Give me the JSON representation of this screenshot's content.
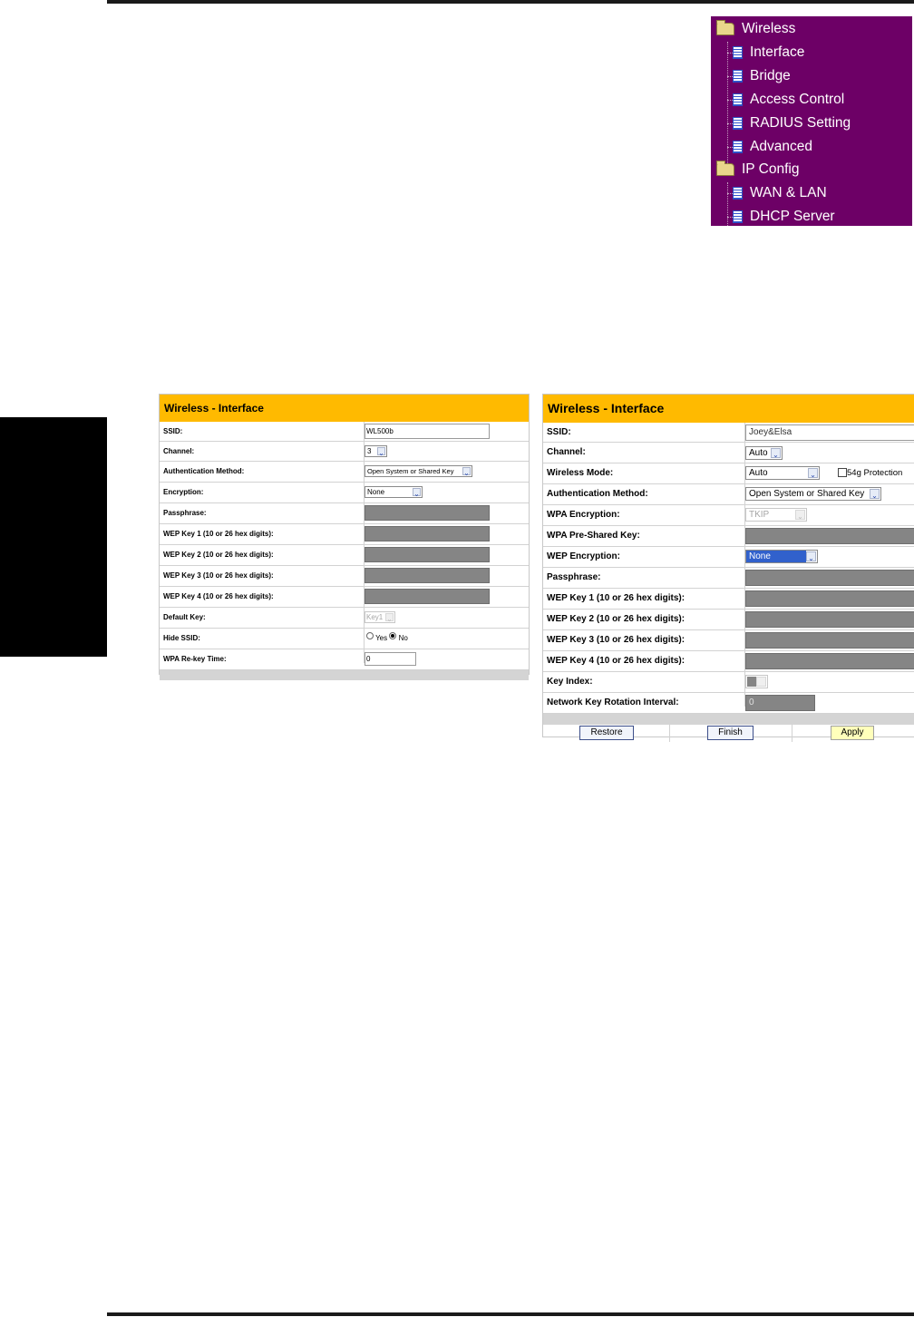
{
  "nav": {
    "items": [
      {
        "label": "Wireless",
        "type": "folder"
      },
      {
        "label": "Interface",
        "type": "page"
      },
      {
        "label": "Bridge",
        "type": "page"
      },
      {
        "label": "Access Control",
        "type": "page"
      },
      {
        "label": "RADIUS Setting",
        "type": "page"
      },
      {
        "label": "Advanced",
        "type": "page"
      },
      {
        "label": "IP Config",
        "type": "folder"
      },
      {
        "label": "WAN & LAN",
        "type": "page"
      },
      {
        "label": "DHCP Server",
        "type": "page"
      }
    ],
    "icons": {
      "folder": "folder-icon",
      "page": "page-icon"
    },
    "colors": {
      "background": "#6d0066",
      "text": "#ffffff"
    }
  },
  "left_panel": {
    "title": "Wireless - Interface",
    "ssid": {
      "label": "SSID:",
      "value": "WL500b"
    },
    "channel": {
      "label": "Channel:",
      "value": "3"
    },
    "auth": {
      "label": "Authentication Method:",
      "value": "Open System or Shared Key"
    },
    "encryption": {
      "label": "Encryption:",
      "value": "None"
    },
    "passphrase": {
      "label": "Passphrase:"
    },
    "wep1": {
      "label": "WEP Key 1 (10 or 26 hex digits):"
    },
    "wep2": {
      "label": "WEP Key 2 (10 or 26 hex digits):"
    },
    "wep3": {
      "label": "WEP Key 3 (10 or 26 hex digits):"
    },
    "wep4": {
      "label": "WEP Key 4 (10 or 26 hex digits):"
    },
    "default_key": {
      "label": "Default Key:",
      "value": "Key1"
    },
    "hide_ssid": {
      "label": "Hide SSID:",
      "yes": "Yes",
      "no": "No",
      "selected": "No"
    },
    "rekey": {
      "label": "WPA Re-key Time:",
      "value": "0"
    }
  },
  "right_panel": {
    "title": "Wireless - Interface",
    "ssid": {
      "label": "SSID:",
      "value": "Joey&Elsa"
    },
    "channel": {
      "label": "Channel:",
      "value": "Auto"
    },
    "mode": {
      "label": "Wireless Mode:",
      "value": "Auto",
      "protection_label": "54g Protection",
      "protection_checked": false
    },
    "auth": {
      "label": "Authentication Method:",
      "value": "Open System or Shared Key"
    },
    "wpa_enc": {
      "label": "WPA Encryption:",
      "value": "TKIP"
    },
    "wpa_psk": {
      "label": "WPA Pre-Shared Key:"
    },
    "wep_enc": {
      "label": "WEP Encryption:",
      "value": "None"
    },
    "passphrase": {
      "label": "Passphrase:"
    },
    "wep1": {
      "label": "WEP Key 1 (10 or 26 hex digits):"
    },
    "wep2": {
      "label": "WEP Key 2 (10 or 26 hex digits):"
    },
    "wep3": {
      "label": "WEP Key 3 (10 or 26 hex digits):"
    },
    "wep4": {
      "label": "WEP Key 4 (10 or 26 hex digits):"
    },
    "key_index": {
      "label": "Key Index:"
    },
    "rotation": {
      "label": "Network Key Rotation Interval:",
      "value": "0"
    },
    "buttons": {
      "restore": "Restore",
      "finish": "Finish",
      "apply": "Apply"
    }
  },
  "colors": {
    "header_accent": "#ffba00",
    "disabled_field": "#858585",
    "side_tab": "#000000"
  }
}
